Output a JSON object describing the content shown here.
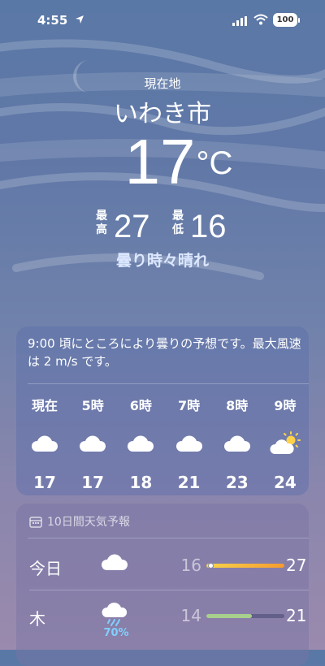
{
  "status_bar": {
    "time": "4:55",
    "battery": "100"
  },
  "location": {
    "label": "現在地",
    "city": "いわき市"
  },
  "current": {
    "temp": "17",
    "unit": "°C",
    "high_label": "最高",
    "high": "27",
    "low_label": "最低",
    "low": "16",
    "condition": "曇り時々晴れ"
  },
  "hourly_card": {
    "summary": "9:00 頃にところにより曇りの予想です。最大風速は 2 m/s です。",
    "hours": [
      {
        "time": "現在",
        "icon": "cloud-icon",
        "temp": "17"
      },
      {
        "time": "5時",
        "icon": "cloud-icon",
        "temp": "17"
      },
      {
        "time": "6時",
        "icon": "cloud-icon",
        "temp": "18"
      },
      {
        "time": "7時",
        "icon": "cloud-icon",
        "temp": "21"
      },
      {
        "time": "8時",
        "icon": "cloud-icon",
        "temp": "23"
      },
      {
        "time": "9時",
        "icon": "partly-sunny-icon",
        "temp": "24"
      }
    ]
  },
  "daily_card": {
    "header": "10日間天気予報",
    "days": [
      {
        "day": "今日",
        "icon": "cloud-icon",
        "precip": "",
        "low": "16",
        "high": "27",
        "range_start": 0.0,
        "range_end": 1.0,
        "current_marker": 0.05,
        "bar_color": "#f5a623"
      },
      {
        "day": "木",
        "icon": "cloud-rain-icon",
        "precip": "70%",
        "low": "14",
        "high": "21",
        "range_start": 0.0,
        "range_end": 0.58,
        "current_marker": null,
        "bar_color": "#a8d08d"
      }
    ]
  },
  "colors": {
    "accent_text": "#dce7ff",
    "precip": "#7fd0ff"
  }
}
